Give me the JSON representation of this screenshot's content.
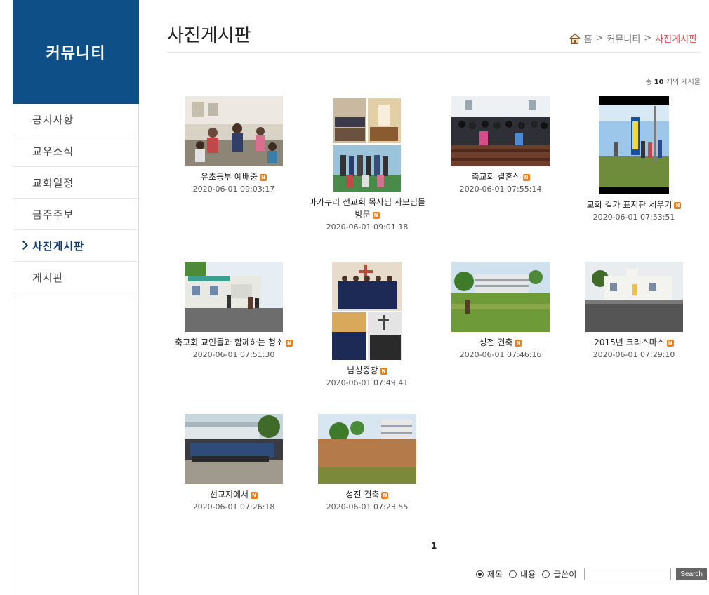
{
  "sidebar": {
    "heading": "커뮤니티",
    "items": [
      {
        "label": "공지사항",
        "active": false
      },
      {
        "label": "교우소식",
        "active": false
      },
      {
        "label": "교회일정",
        "active": false
      },
      {
        "label": "금주주보",
        "active": false
      },
      {
        "label": "사진게시판",
        "active": true
      },
      {
        "label": "게시판",
        "active": false
      }
    ]
  },
  "page": {
    "title": "사진게시판",
    "breadcrumb": [
      "홈",
      "커뮤니티",
      "사진게시판"
    ],
    "breadcrumb_sep": ">",
    "count_prefix": "총",
    "count": "10",
    "count_suffix": "개의 게시물"
  },
  "posts": [
    {
      "title": "유초등부 예배중",
      "date": "2020-06-01 09:03:17",
      "thumb": "kids-class-photo"
    },
    {
      "title": "마카누리 선교회 목사님 사모님들 방문",
      "date": "2020-06-01 09:01:18",
      "thumb": "visit-collage-photo"
    },
    {
      "title": "축교회 결혼식",
      "date": "2020-06-01 07:55:14",
      "thumb": "wedding-photo"
    },
    {
      "title": "교회 길가 표지판 세우기",
      "date": "2020-06-01 07:53:51",
      "thumb": "signboard-photo"
    },
    {
      "title": "축교회 교인들과 함께하는 청소",
      "date": "2020-06-01 07:51:30",
      "thumb": "cleaning-photo"
    },
    {
      "title": "남성중창",
      "date": "2020-06-01 07:49:41",
      "thumb": "choir-collage-photo"
    },
    {
      "title": "성전 건축",
      "date": "2020-06-01 07:46:16",
      "thumb": "construction-field-photo"
    },
    {
      "title": "2015년 크리스마스",
      "date": "2020-06-01 07:29:10",
      "thumb": "christmas-church-photo"
    },
    {
      "title": "선교지에서",
      "date": "2020-06-01 07:26:18",
      "thumb": "mission-group-photo"
    },
    {
      "title": "성전 건축",
      "date": "2020-06-01 07:23:55",
      "thumb": "construction-site-photo"
    }
  ],
  "new_badge": "N",
  "pagination": {
    "current": "1"
  },
  "search": {
    "options": [
      {
        "label": "제목",
        "checked": true
      },
      {
        "label": "내용",
        "checked": false
      },
      {
        "label": "글쓴이",
        "checked": false
      }
    ],
    "value": "",
    "button": "Search"
  },
  "icons": {
    "home": "home-icon",
    "new": "new-badge-icon",
    "active": "chevron-right-icon"
  },
  "colors": {
    "sidebar_head": "#0d4f86",
    "active_text": "#0d3a6b",
    "breadcrumb_current": "#e05050",
    "new_badge": "#e8801e"
  }
}
